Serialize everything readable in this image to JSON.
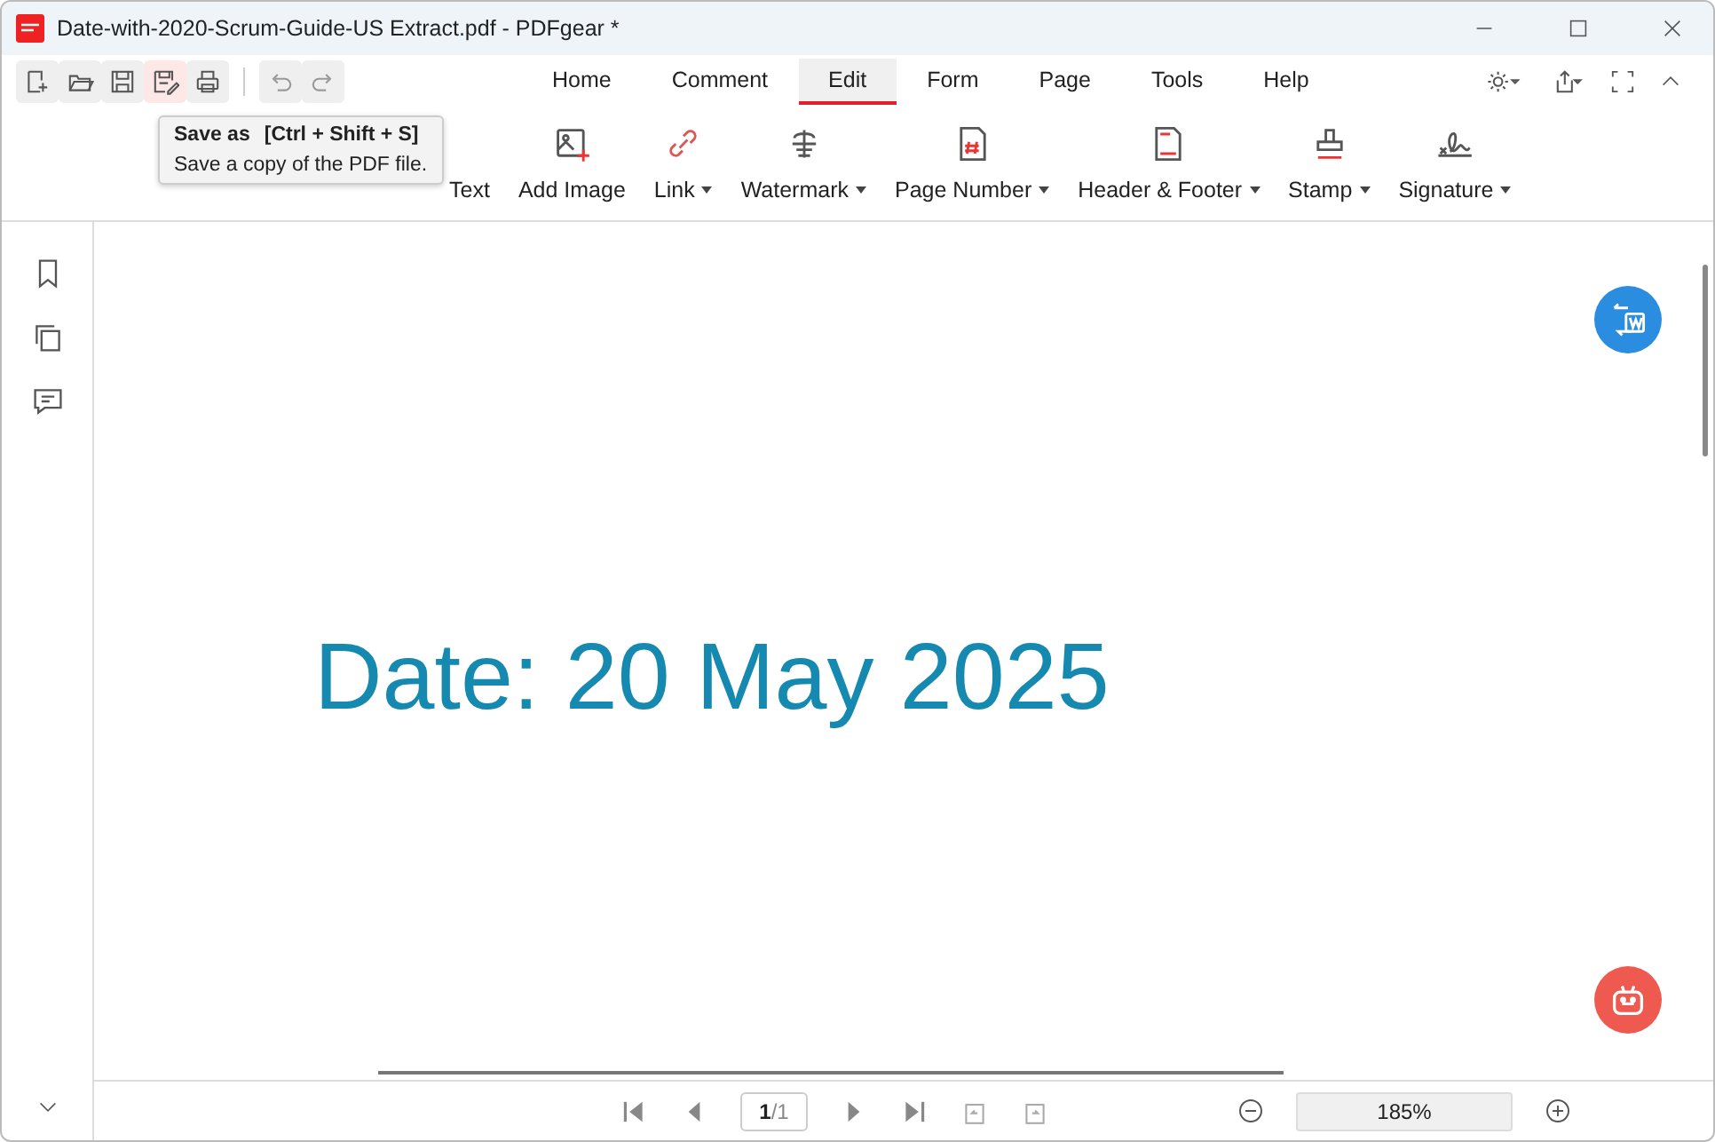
{
  "window": {
    "title": "Date-with-2020-Scrum-Guide-US Extract.pdf - PDFgear *"
  },
  "quick_tools": [
    {
      "kind": "new",
      "hovered": false
    },
    {
      "kind": "open",
      "hovered": false
    },
    {
      "kind": "save",
      "hovered": false
    },
    {
      "kind": "save-as",
      "hovered": true
    },
    {
      "kind": "print",
      "hovered": false
    },
    {
      "kind": "undo",
      "hovered": false
    },
    {
      "kind": "redo",
      "hovered": false
    }
  ],
  "menu_tabs": [
    {
      "label": "Home",
      "selected": false
    },
    {
      "label": "Comment",
      "selected": false
    },
    {
      "label": "Edit",
      "selected": true
    },
    {
      "label": "Form",
      "selected": false
    },
    {
      "label": "Page",
      "selected": false
    },
    {
      "label": "Tools",
      "selected": false
    },
    {
      "label": "Help",
      "selected": false
    }
  ],
  "ribbon": [
    {
      "kind": "add-text",
      "label": "Text",
      "dropdown": false
    },
    {
      "kind": "add-image",
      "label": "Add Image",
      "dropdown": false
    },
    {
      "kind": "link",
      "label": "Link",
      "dropdown": true
    },
    {
      "kind": "watermark",
      "label": "Watermark",
      "dropdown": true
    },
    {
      "kind": "page-number",
      "label": "Page Number",
      "dropdown": true
    },
    {
      "kind": "header-footer",
      "label": "Header & Footer",
      "dropdown": true
    },
    {
      "kind": "stamp",
      "label": "Stamp",
      "dropdown": true
    },
    {
      "kind": "signature",
      "label": "Signature",
      "dropdown": true
    }
  ],
  "tooltip": {
    "title": "Save as",
    "shortcut": "[Ctrl + Shift + S]",
    "description": "Save a copy of the PDF file."
  },
  "document": {
    "text": "Date: 20 May 2025"
  },
  "page_nav": {
    "current": "1",
    "total": "/1"
  },
  "zoom": {
    "value": "185%"
  }
}
